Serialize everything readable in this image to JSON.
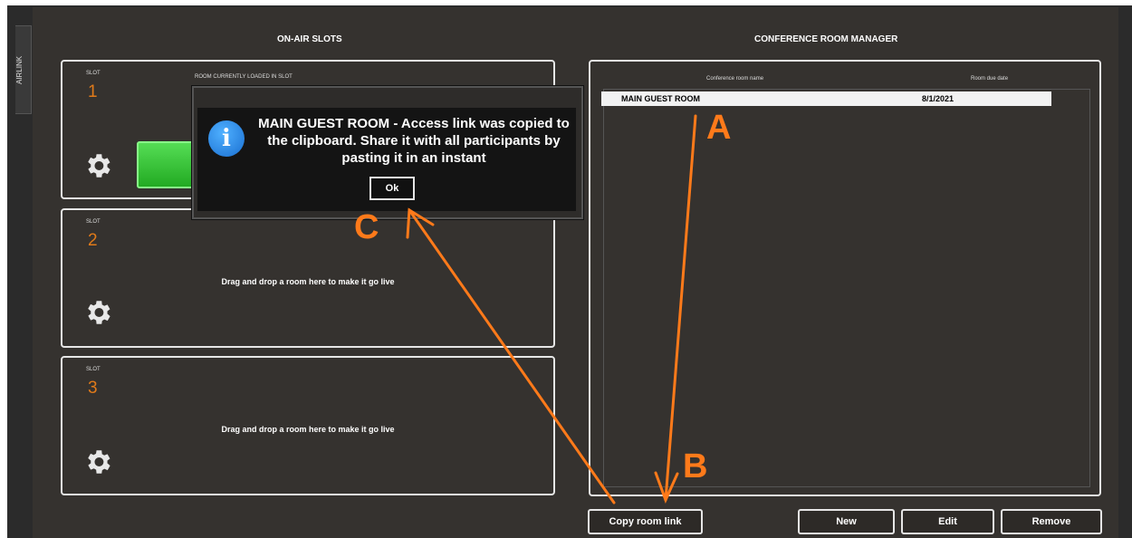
{
  "side_tab": {
    "label": "AIRLINK"
  },
  "on_air": {
    "title": "ON-AIR SLOTS",
    "slot_label": "SLOT",
    "slots": [
      {
        "number": "1",
        "loaded_label": "ROOM CURRENTLY LOADED IN SLOT",
        "drop_text": ""
      },
      {
        "number": "2",
        "drop_text": "Drag and drop a room here to make it go live"
      },
      {
        "number": "3",
        "drop_text": "Drag and drop a room here to make it go live"
      }
    ]
  },
  "conference": {
    "title": "CONFERENCE ROOM MANAGER",
    "col_name": "Conference room name",
    "col_date": "Room due date",
    "rows": [
      {
        "name": "MAIN GUEST ROOM",
        "date": "8/1/2021",
        "selected": true
      }
    ]
  },
  "buttons": {
    "copy_link": "Copy room link",
    "new": "New",
    "edit": "Edit",
    "remove": "Remove"
  },
  "dialog": {
    "message": "MAIN GUEST ROOM - Access link was copied to the clipboard. Share it with all participants by pasting it in an instant",
    "ok": "Ok",
    "icon": "info-icon"
  },
  "annotations": {
    "a": "A",
    "b": "B",
    "c": "C",
    "color": "#ff7a1a"
  },
  "colors": {
    "slot_number": "#e07a1a",
    "panel_bg": "#35322f"
  }
}
